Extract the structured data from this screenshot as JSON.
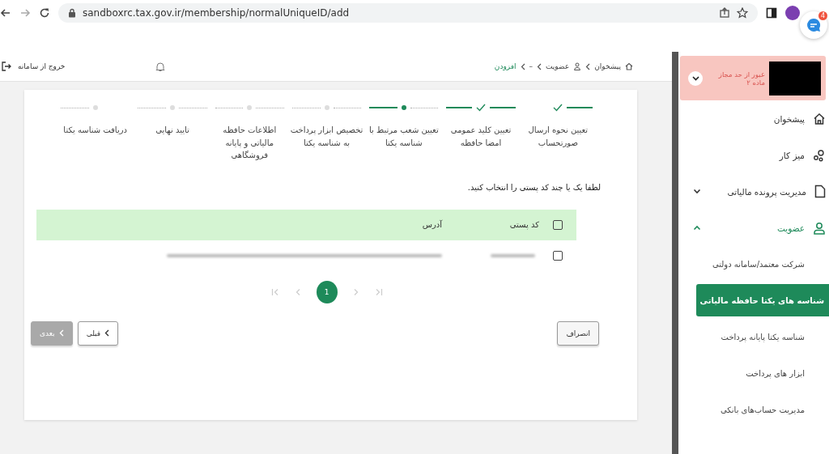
{
  "browser": {
    "url": "sandboxrc.tax.gov.ir/membership/normalUniqueID/add",
    "chat_badge": "4"
  },
  "header": {
    "breadcrumbs": [
      {
        "label": "پیشخوان",
        "current": false
      },
      {
        "label": "عضویت",
        "current": false
      },
      {
        "label": "–",
        "current": false
      },
      {
        "label": "افزودن",
        "current": true
      }
    ],
    "logout": "خروج از سامانه"
  },
  "stepper": [
    {
      "label": "تعیین نحوه ارسال صورتحساب",
      "completed": true,
      "active": false
    },
    {
      "label": "تعیین کلید عمومی امضا حافظه",
      "completed": true,
      "active": false
    },
    {
      "label": "تعیین شعب مرتبط با شناسه یکتا",
      "completed": false,
      "active": true
    },
    {
      "label": "تخصیص ابزار پرداخت به شناسه یکتا",
      "completed": false,
      "active": false
    },
    {
      "label": "اطلاعات حافظه مالیاتی و پایانه فروشگاهی",
      "completed": false,
      "active": false
    },
    {
      "label": "تایید نهایی",
      "completed": false,
      "active": false
    },
    {
      "label": "دریافت شناسه یکتا",
      "completed": false,
      "active": false
    }
  ],
  "prompt": "لطفا یک یا چند کد پستی را انتخاب کنید.",
  "table": {
    "columns": [
      "کد پستی",
      "آدرس"
    ],
    "header_checked": false,
    "rows": [
      {
        "checked": false
      }
    ]
  },
  "pagination": {
    "pages": [
      {
        "label": "1",
        "selected": true
      }
    ]
  },
  "buttons": {
    "cancel": "انصراف",
    "previous": "قبلی",
    "next": {
      "label": "بعدی",
      "disabled": true
    }
  },
  "sidebar": {
    "alert": {
      "lines": [
        "عبور از حد مجاز",
        "ماده ۲"
      ]
    },
    "items": [
      {
        "label": "پیشخوان",
        "selected": false
      },
      {
        "label": "میز کار",
        "selected": false
      },
      {
        "label": "مدیریت پرونده مالیاتی",
        "selected": false,
        "expanded": false
      },
      {
        "label": "عضویت",
        "selected": true,
        "expanded": true,
        "children": [
          {
            "label": "شرکت معتمد/سامانه دولتی",
            "selected": false
          },
          {
            "label": "شناسه های یکتا حافظه مالیاتی",
            "selected": true
          },
          {
            "label": "شناسه یکتا پایانه پرداخت",
            "selected": false
          },
          {
            "label": "ابزار های پرداخت",
            "selected": false
          },
          {
            "label": "مدیریت حساب‌های بانکی",
            "selected": false
          }
        ]
      }
    ]
  }
}
